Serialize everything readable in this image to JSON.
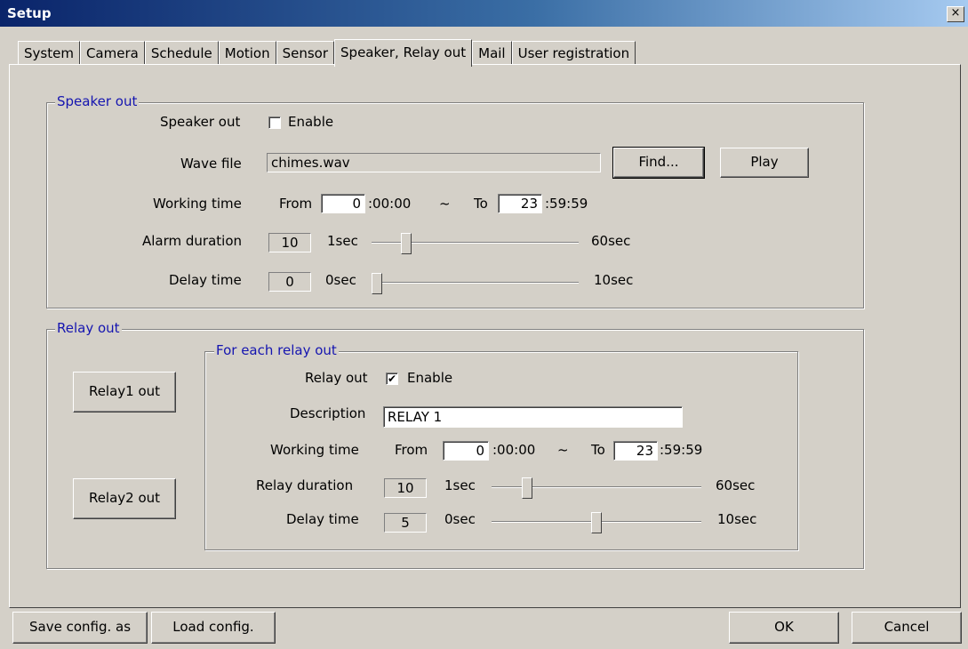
{
  "window": {
    "title": "Setup",
    "close_glyph": "×"
  },
  "tabs": [
    "System",
    "Camera",
    "Schedule",
    "Motion",
    "Sensor",
    "Speaker, Relay out",
    "Mail",
    "User registration"
  ],
  "active_tab": "Speaker, Relay out",
  "speaker": {
    "group_title": "Speaker out",
    "speaker_out_label": "Speaker out",
    "enable_label": "Enable",
    "enable_checked": false,
    "wave_file_label": "Wave file",
    "wave_file_value": "chimes.wav",
    "find_button": "Find...",
    "play_button": "Play",
    "working_time_label": "Working time",
    "from_label": "From",
    "from_value": "0",
    "from_suffix": ":00:00",
    "tilde": "~",
    "to_label": "To",
    "to_value": "23",
    "to_suffix": ":59:59",
    "alarm_duration_label": "Alarm duration",
    "alarm_duration_value": "10",
    "alarm_min": "1sec",
    "alarm_max": "60sec",
    "alarm_slider_fraction": 0.15,
    "delay_time_label": "Delay time",
    "delay_time_value": "0",
    "delay_min": "0sec",
    "delay_max": "10sec",
    "delay_slider_fraction": 0.0
  },
  "relay": {
    "group_title": "Relay out",
    "relay1_button": "Relay1 out",
    "relay2_button": "Relay2 out",
    "each_title": "For each relay out",
    "relay_out_label": "Relay out",
    "enable_label": "Enable",
    "enable_checked": true,
    "check_glyph": "✔",
    "description_label": "Description",
    "description_value": "RELAY 1",
    "working_time_label": "Working time",
    "from_label": "From",
    "from_value": "0",
    "from_suffix": ":00:00",
    "tilde": "~",
    "to_label": "To",
    "to_value": "23",
    "to_suffix": ":59:59",
    "relay_duration_label": "Relay duration",
    "relay_duration_value": "10",
    "relay_min": "1sec",
    "relay_max": "60sec",
    "relay_slider_fraction": 0.15,
    "delay_time_label": "Delay time",
    "delay_time_value": "5",
    "delay_min": "0sec",
    "delay_max": "10sec",
    "delay_slider_fraction": 0.5
  },
  "footer": {
    "save_button": "Save config. as",
    "load_button": "Load config.",
    "ok_button": "OK",
    "cancel_button": "Cancel"
  },
  "colors": {
    "group_title": "#1515b0",
    "title_bar": "#0a246a",
    "face": "#d4d0c8"
  }
}
